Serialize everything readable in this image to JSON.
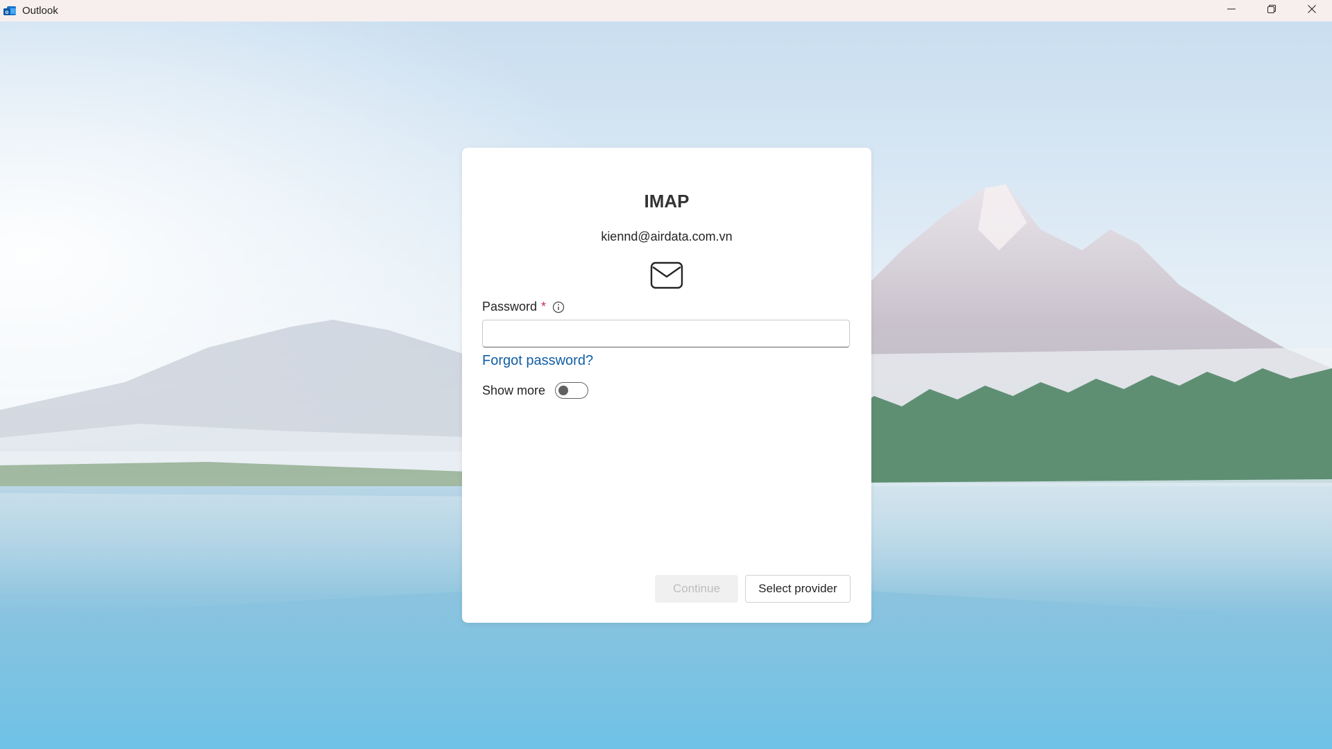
{
  "window": {
    "title": "Outlook",
    "app_icon": "outlook-icon",
    "controls": {
      "minimize": "minimize-icon",
      "restore": "restore-icon",
      "close": "close-icon"
    }
  },
  "dialog": {
    "title": "IMAP",
    "email": "kiennd@airdata.com.vn",
    "icon": "mail-icon",
    "password": {
      "label": "Password",
      "required_marker": "*",
      "info_icon": "info-icon",
      "value": "",
      "placeholder": ""
    },
    "forgot_password_label": "Forgot password?",
    "show_more": {
      "label": "Show more",
      "enabled": false
    },
    "buttons": {
      "continue_label": "Continue",
      "continue_disabled": true,
      "select_provider_label": "Select provider"
    }
  },
  "colors": {
    "link": "#115ea3",
    "required": "#c4314b",
    "titlebar": "#f7efee",
    "card": "#ffffff"
  }
}
